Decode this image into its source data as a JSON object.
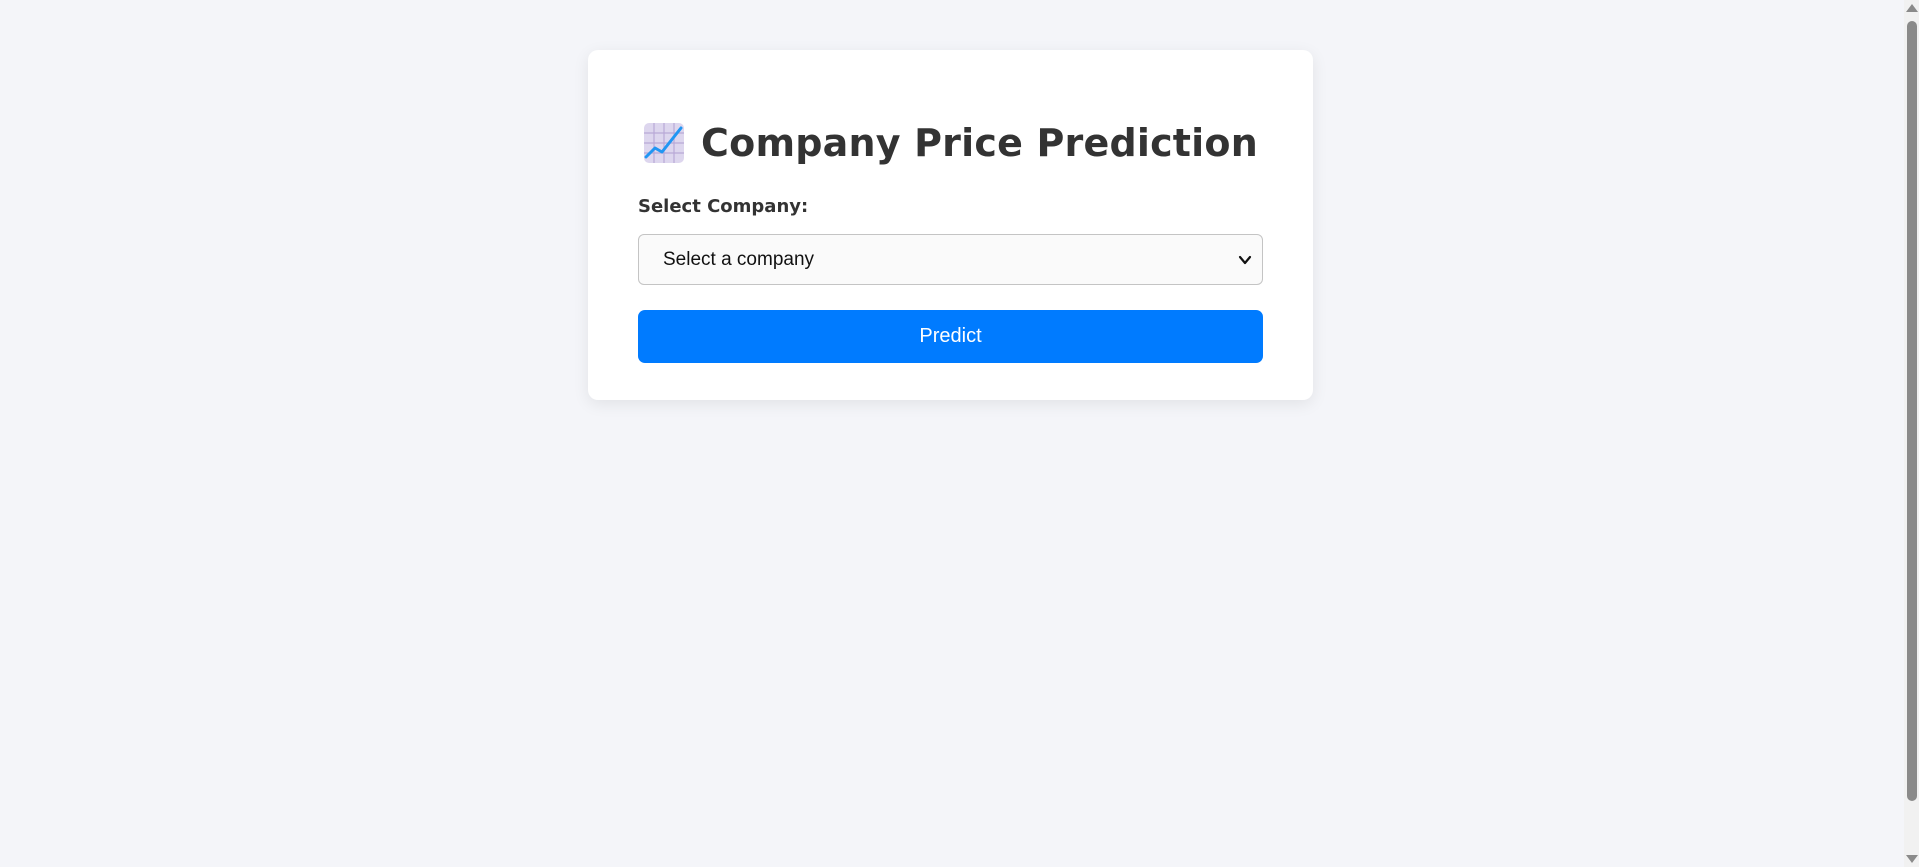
{
  "page": {
    "title": "Company Price Prediction",
    "title_icon": "chart-increasing-icon"
  },
  "form": {
    "company_label": "Select Company:",
    "company_select": {
      "selected": "Select a company",
      "options": [
        "Select a company"
      ]
    },
    "predict_label": "Predict"
  },
  "colors": {
    "background": "#f4f5f9",
    "card": "#ffffff",
    "primary_button": "#007bff",
    "heading_text": "#333333"
  }
}
